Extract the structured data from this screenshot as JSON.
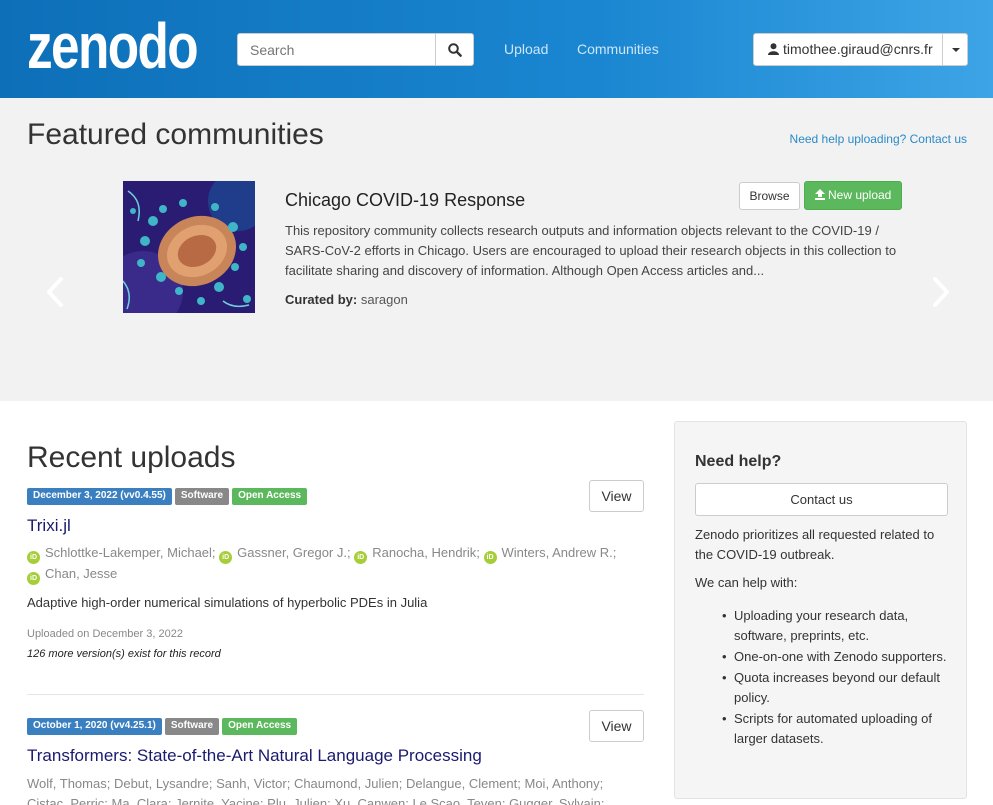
{
  "header": {
    "logo_text": "zenodo",
    "search_placeholder": "Search",
    "nav": [
      "Upload",
      "Communities"
    ],
    "user": "timothee.giraud@cnrs.fr"
  },
  "featured": {
    "title": "Featured communities",
    "help_link": "Need help uploading? Contact us",
    "community": {
      "name": "Chicago COVID-19 Response",
      "browse_label": "Browse",
      "new_upload_label": "New upload",
      "description": "This repository community collects research outputs and information objects relevant to the COVID-19 / SARS-CoV-2 efforts in Chicago. Users are encouraged to upload their research objects in this collection to facilitate sharing and discovery of information. Although Open Access articles and...",
      "curated_label": "Curated by:",
      "curator": "saragon"
    }
  },
  "recent": {
    "title": "Recent uploads",
    "records": [
      {
        "date_badge": "December 3, 2022 (vv0.4.55)",
        "type_badge": "Software",
        "access_badge": "Open Access",
        "view_label": "View",
        "title": "Trixi.jl",
        "authors_line1": [
          "Schlottke-Lakemper, Michael;",
          "Gassner, Gregor J.;",
          "Ranocha, Hendrik;",
          "Winters, Andrew R.;"
        ],
        "authors_line2": [
          "Chan, Jesse"
        ],
        "description": "Adaptive high-order numerical simulations of hyperbolic PDEs in Julia",
        "uploaded": "Uploaded on December 3, 2022",
        "versions": "126 more version(s) exist for this record"
      },
      {
        "date_badge": "October 1, 2020 (vv4.25.1)",
        "type_badge": "Software",
        "access_badge": "Open Access",
        "view_label": "View",
        "title": "Transformers: State-of-the-Art Natural Language Processing",
        "authors_line1": [
          "Wolf, Thomas;",
          "Debut, Lysandre;",
          "Sanh, Victor;",
          "Chaumond, Julien;",
          "Delangue, Clement;",
          "Moi, Anthony;"
        ],
        "authors_line2": [
          "Cistac, Perric;",
          "Ma, Clara;",
          "Jernite, Yacine;",
          "Plu, Julien;",
          "Xu, Canwen;",
          "Le Scao, Teven;",
          "Gugger, Sylvain;"
        ]
      }
    ]
  },
  "sidebar": {
    "title": "Need help?",
    "contact_label": "Contact us",
    "intro": "Zenodo prioritizes all requested related to the COVID-19 outbreak.",
    "help_lead": "We can help with:",
    "items": [
      "Uploading your research data, software, preprints, etc.",
      "One-on-one with Zenodo supporters.",
      "Quota increases beyond our default policy.",
      "Scripts for automated uploading of larger datasets."
    ]
  },
  "colors": {
    "header_gradient_start": "#0d6fb8",
    "header_gradient_end": "#3da4e6",
    "badge_date": "#3a7fc0",
    "badge_type": "#888888",
    "badge_open_access": "#5cb85c",
    "new_upload_button": "#5cb85c",
    "orcid": "#a6ce39"
  }
}
